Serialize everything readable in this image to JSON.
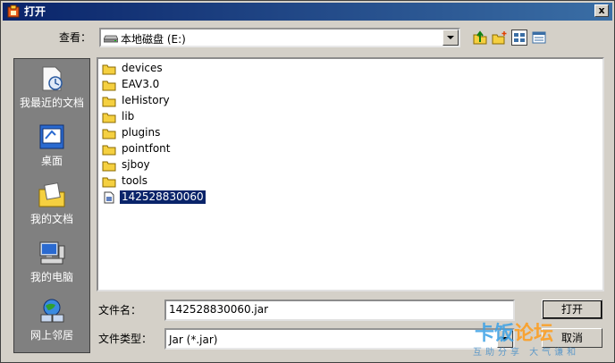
{
  "window": {
    "title": "打开",
    "close_label": "x"
  },
  "lookin": {
    "label": "查看：",
    "value": "本地磁盘 (E:)"
  },
  "places": [
    {
      "label": "我最近的文档"
    },
    {
      "label": "桌面"
    },
    {
      "label": "我的文档"
    },
    {
      "label": "我的电脑"
    },
    {
      "label": "网上邻居"
    }
  ],
  "files": [
    {
      "name": "devices",
      "type": "folder"
    },
    {
      "name": "EAV3.0",
      "type": "folder"
    },
    {
      "name": "IeHistory",
      "type": "folder"
    },
    {
      "name": "lib",
      "type": "folder"
    },
    {
      "name": "plugins",
      "type": "folder"
    },
    {
      "name": "pointfont",
      "type": "folder"
    },
    {
      "name": "sjboy",
      "type": "folder"
    },
    {
      "name": "tools",
      "type": "folder"
    },
    {
      "name": "142528830060",
      "type": "file",
      "selected": true
    }
  ],
  "filename": {
    "label": "文件名：",
    "value": "142528830060.jar"
  },
  "filetype": {
    "label": "文件类型：",
    "value": "Jar (*.jar)"
  },
  "buttons": {
    "open": "打开",
    "cancel": "取消"
  },
  "watermark": {
    "main_a": "卡饭",
    "main_b": "论坛",
    "sub": "互助分享 大气谦和"
  },
  "colors": {
    "titlebar_start": "#0a246a",
    "titlebar_end": "#3a6ea5",
    "selection": "#0a246a",
    "places_bg": "#808080"
  }
}
